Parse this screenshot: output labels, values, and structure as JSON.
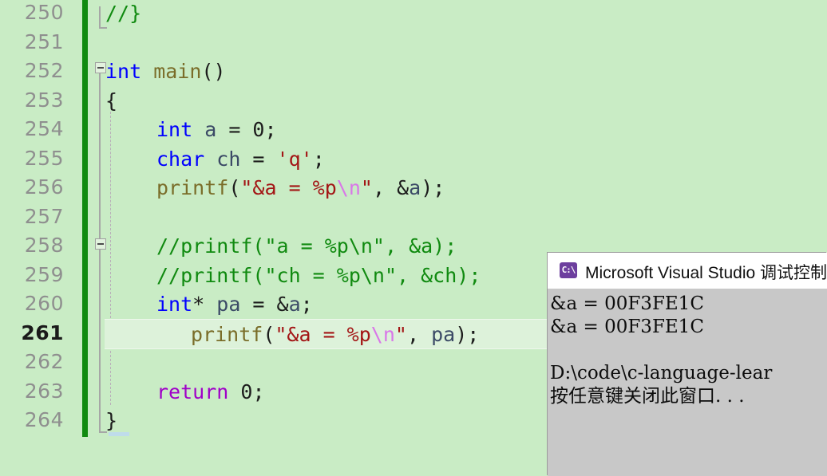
{
  "editor": {
    "language": "c",
    "colors": {
      "background": "#c9ecc5",
      "current_line": "#ddf2da",
      "change_bar": "#108a10",
      "line_number": "#8f8f8f",
      "keyword": "#0000ff",
      "control_keyword": "#a000c8",
      "function": "#7a6d29",
      "string": "#a31515",
      "escape": "#d977e8",
      "comment": "#108a10",
      "variable": "#3b4a66"
    },
    "current_line_number": "261",
    "lines": [
      {
        "number": "250",
        "text": "//}"
      },
      {
        "number": "251",
        "text": ""
      },
      {
        "number": "252",
        "text": "int main()"
      },
      {
        "number": "253",
        "text": "{"
      },
      {
        "number": "254",
        "text": "    int a = 0;"
      },
      {
        "number": "255",
        "text": "    char ch = 'q';"
      },
      {
        "number": "256",
        "text": "    printf(\"&a = %p\\n\", &a);"
      },
      {
        "number": "257",
        "text": ""
      },
      {
        "number": "258",
        "text": "    //printf(\"a = %p\\n\", &a);"
      },
      {
        "number": "259",
        "text": "    //printf(\"ch = %p\\n\", &ch);"
      },
      {
        "number": "260",
        "text": "    int* pa = &a;"
      },
      {
        "number": "261",
        "text": "    printf(\"&a = %p\\n\", pa);"
      },
      {
        "number": "262",
        "text": ""
      },
      {
        "number": "263",
        "text": "    return 0;"
      },
      {
        "number": "264",
        "text": "}"
      }
    ],
    "tokens": {
      "l250": {
        "comment": "//}"
      },
      "l252": {
        "kw": "int",
        "fn": " main",
        "plain": "()"
      },
      "l253": {
        "plain": "{"
      },
      "l254": {
        "kw": "int",
        "var": " a",
        "plain": " = ",
        "num": "0;"
      },
      "l255": {
        "kw": "char",
        "var": " ch",
        "plain": " = ",
        "str": "'q'",
        "end": ";"
      },
      "l256": {
        "fn": "printf",
        "plain": "(",
        "str": "\"&a = %p",
        "esc": "\\n",
        "str2": "\"",
        "plain2": ", ",
        "amp": "&",
        "var": "a",
        "plain3": ");"
      },
      "l258": {
        "comment": "//printf(\"a = %p\\n\", &a);"
      },
      "l259": {
        "comment": "//printf(\"ch = %p\\n\", &ch);"
      },
      "l260": {
        "kw": "int",
        "plain": "* ",
        "var": "pa",
        "plain2": " = ",
        "amp": "&",
        "var2": "a",
        "end": ";"
      },
      "l261": {
        "fn": "printf",
        "plain": "(",
        "str": "\"&a = %p",
        "esc": "\\n",
        "str2": "\"",
        "plain2": ", ",
        "var": "pa",
        "plain3": ");"
      },
      "l263": {
        "kwctl": "return",
        "plain": " ",
        "num": "0",
        "end": ";"
      },
      "l264": {
        "plain": "}"
      }
    }
  },
  "console": {
    "title": "Microsoft Visual Studio 调试控制台",
    "icon": "console-cmd-icon",
    "icon_text": "C:\\",
    "background": "#c8c8c8",
    "titlebar_background": "#ffffff",
    "output": [
      "&a = 00F3FE1C",
      "&a = 00F3FE1C",
      "",
      "D:\\code\\c-language-lear",
      "按任意键关闭此窗口. . ."
    ]
  }
}
